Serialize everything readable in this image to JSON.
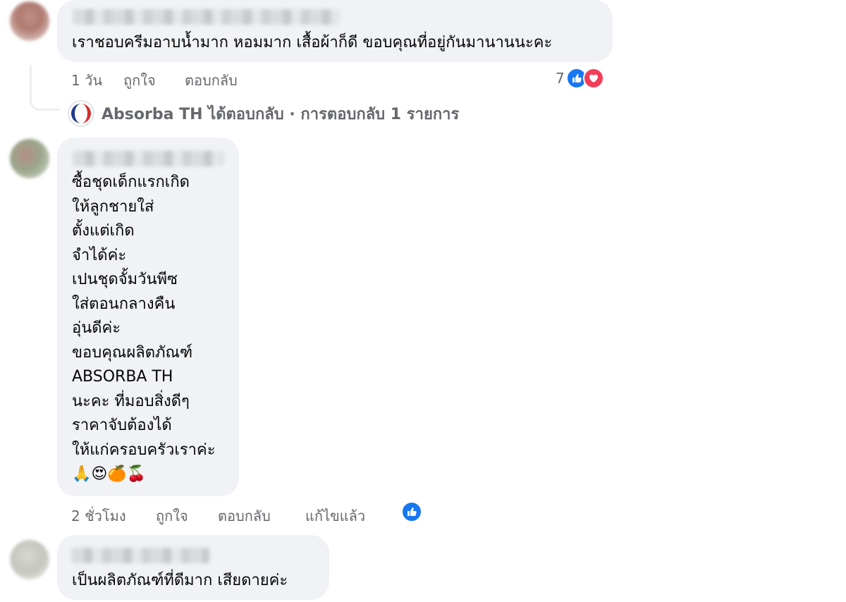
{
  "colors": {
    "bubble": "#f0f2f5",
    "meta_text": "#65676b",
    "like_blue": "#1877f2",
    "love_red": "#f33e58"
  },
  "comments": [
    {
      "text": "เราชอบครีมอาบน้ำมาก หอมมาก เสื้อผ้าก็ดี ขอบคุณที่อยู่กันมานานนะคะ",
      "time": "1 วัน",
      "like_label": "ถูกใจ",
      "reply_label": "ตอบกลับ",
      "reaction_count": "7",
      "reaction_icons": [
        "like-icon",
        "love-icon"
      ]
    },
    {
      "lines": [
        "ซื้อชุดเด็กแรกเกิด",
        "ให้ลูกชายใส่",
        "ตั้งแต่เกิด",
        "จำได้ค่ะ",
        "เปนชุดจั้มวันพีซ",
        "ใส่ตอนกลางคืน",
        "อุ่นดีค่ะ",
        "ขอบคุณผลิตภัณฑ์",
        "ABSORBA TH",
        "นะคะ ที่มอบสิ่งดีๆ",
        "ราคาจับต้องได้",
        "ให้แก่ครอบครัวเราค่ะ"
      ],
      "emojis": "🙏😍🍊🍒",
      "time": "2 ชั่วโมง",
      "like_label": "ถูกใจ",
      "reply_label": "ตอบกลับ",
      "edited_label": "แก้ไขแล้ว",
      "reaction_icons": [
        "like-icon"
      ]
    },
    {
      "text": "เป็นผลิตภัณฑ์ที่ดีมาก เสียดายค่ะ"
    }
  ],
  "page_reply": {
    "text": "Absorba TH ได้ตอบกลับ · การตอบกลับ 1 รายการ",
    "logo_icon": "absorba-logo-icon"
  }
}
